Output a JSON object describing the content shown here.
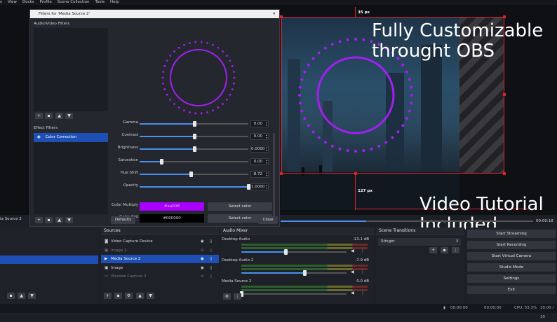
{
  "menu": [
    "s",
    "View",
    "Docks",
    "Profile",
    "Scene Collection",
    "Tools",
    "Help"
  ],
  "preview": {
    "dim_top": "35 px",
    "dim_bottom": "127 px",
    "promo_line1": "Fully Customizable",
    "promo_line2": "throught OBS",
    "promo_line3": "Video Tutorial",
    "promo_line4": "Included"
  },
  "dialog": {
    "title": "Filters for 'Media Source 2'",
    "close_glyph": "✕",
    "av_filters_label": "Audio/Video Filters",
    "effect_filters_label": "Effect Filters",
    "effect_filters": [
      {
        "label": "Color Correction"
      }
    ],
    "rows": [
      {
        "label": "Gamma",
        "value": "0.00",
        "fraction": 0.5
      },
      {
        "label": "Contrast",
        "value": "0.00",
        "fraction": 0.5
      },
      {
        "label": "Brightness",
        "value": "0.0000",
        "fraction": 0.5
      },
      {
        "label": "Saturation",
        "value": "0.00",
        "fraction": 0.2
      },
      {
        "label": "Hue Shift",
        "value": "-8.72",
        "fraction": 0.47
      },
      {
        "label": "Opacity",
        "value": "1.0000",
        "fraction": 1.0
      }
    ],
    "color_multiply_label": "Color Multiply",
    "color_multiply_value": "#aa00ff",
    "color_add_label": "Color Add",
    "color_add_value": "#000000",
    "select_color": "Select color",
    "defaults": "Defaults",
    "close": "Close",
    "accent": "#a020f0"
  },
  "left_dock": {
    "item": "ia Source 2"
  },
  "sources": {
    "header": "Sources",
    "items": [
      {
        "label": "Video Capture Device",
        "icon": "camera-icon",
        "dim": false,
        "selected": false
      },
      {
        "label": "Image 2",
        "icon": "image-icon",
        "dim": true,
        "selected": false
      },
      {
        "label": "Media Source 2",
        "icon": "play-icon",
        "dim": false,
        "selected": true
      },
      {
        "label": "Image",
        "icon": "image-icon",
        "dim": false,
        "selected": false
      },
      {
        "label": "Window Capture 2",
        "icon": "window-icon",
        "dim": true,
        "selected": false
      }
    ]
  },
  "mixer": {
    "header": "Audio Mixer",
    "channels": [
      {
        "name": "Desktop Audio",
        "db": "-13.1 dB",
        "level": 0.42
      },
      {
        "name": "Desktop Audio 2",
        "db": "-7.9 dB",
        "level": 0.6
      },
      {
        "name": "Media Source 2",
        "db": "0.0 dB",
        "level": 0.0
      }
    ]
  },
  "transitions": {
    "header": "Scene Transitions",
    "selected": "Stinger"
  },
  "controls": [
    "Start Streaming",
    "Start Recording",
    "Start Virtual Camera",
    "Studio Mode",
    "Settings",
    "Exit"
  ],
  "timeline": {
    "time": "00:00:18",
    "progress": 0.34
  },
  "status": {
    "t1": "00:00:00",
    "t2": "00:00:00",
    "cpu": "CPU: 53.3%",
    "fps": "30.00 / 30"
  }
}
